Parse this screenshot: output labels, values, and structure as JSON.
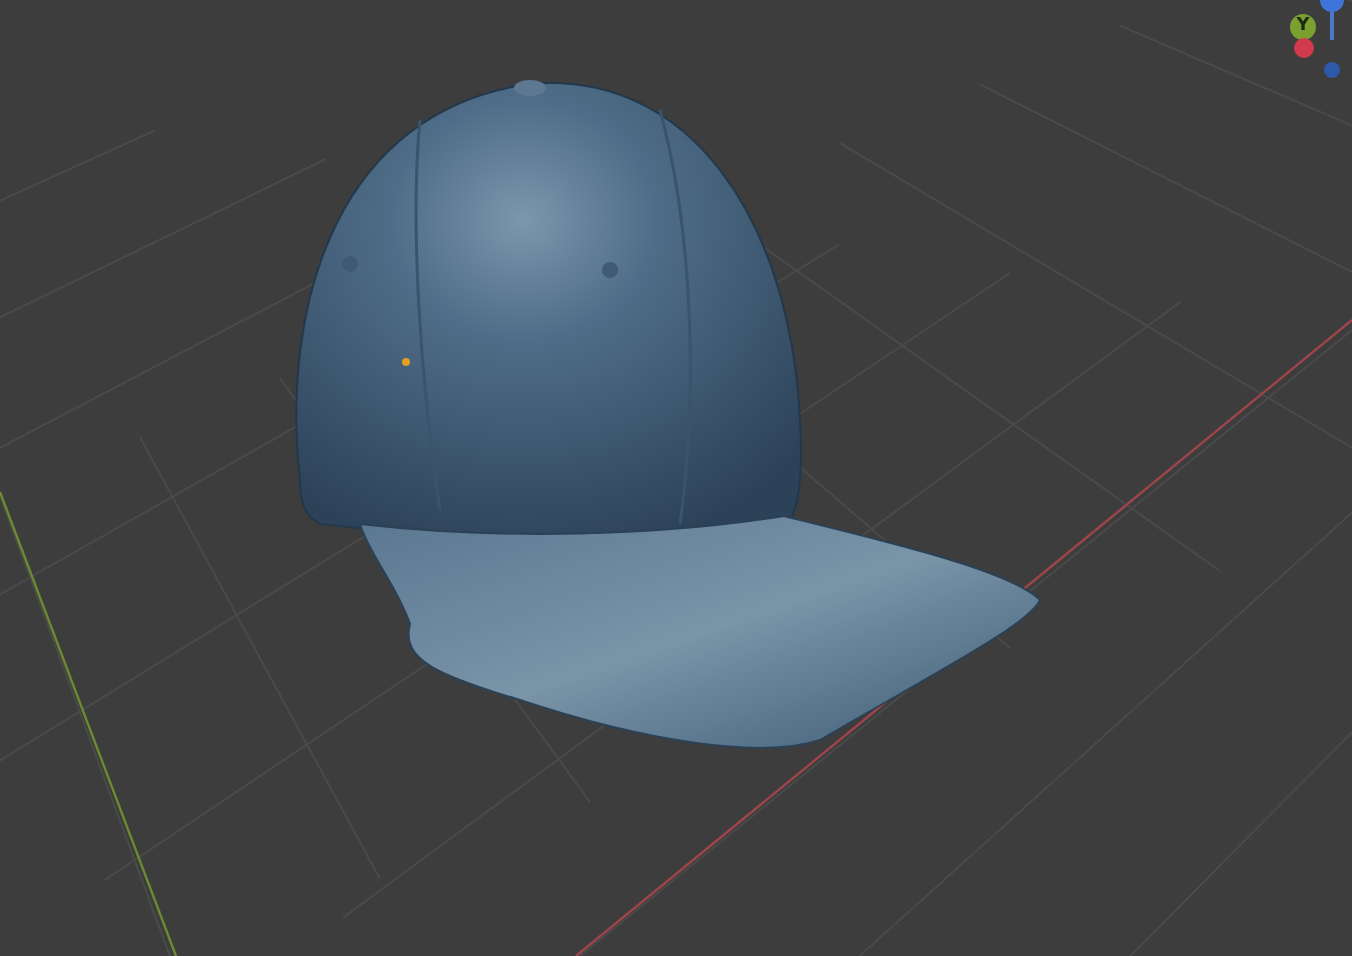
{
  "viewport": {
    "gizmo": {
      "y_axis_label": "Y"
    }
  }
}
